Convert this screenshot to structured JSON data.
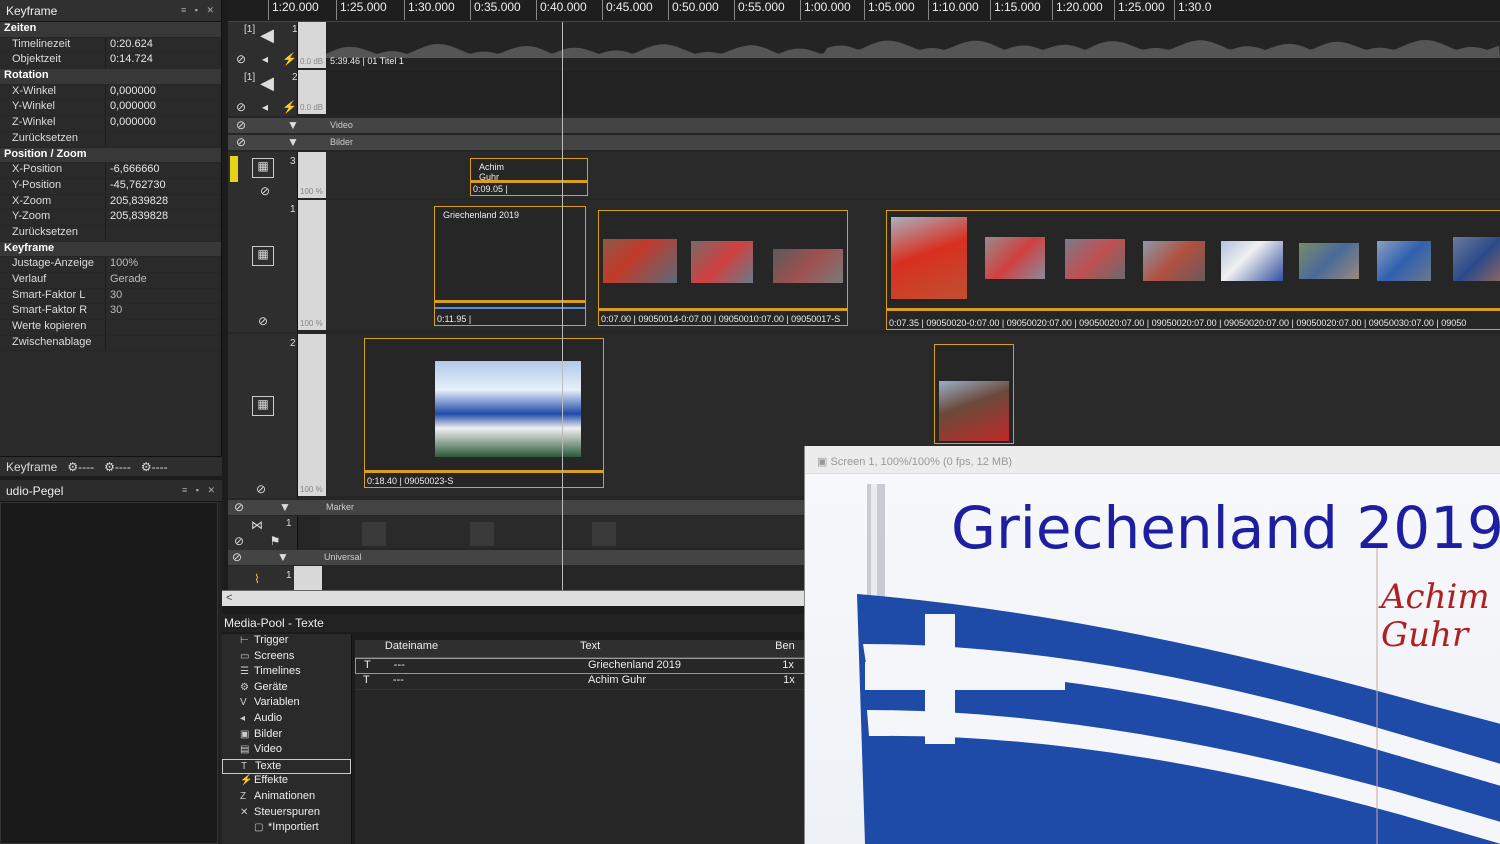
{
  "keyframe_panel": {
    "title": "Keyframe",
    "rows": [
      {
        "section": true,
        "key": "Zeiten"
      },
      {
        "key": "Timelinezeit",
        "value": "0:20.624"
      },
      {
        "key": "Objektzeit",
        "value": "0:14.724"
      },
      {
        "section": true,
        "key": "Rotation"
      },
      {
        "key": "X-Winkel",
        "value": "0,000000"
      },
      {
        "key": "Y-Winkel",
        "value": "0,000000"
      },
      {
        "key": "Z-Winkel",
        "value": "0,000000"
      },
      {
        "key": "Zurücksetzen",
        "value": ""
      },
      {
        "section": true,
        "key": "Position / Zoom"
      },
      {
        "key": "X-Position",
        "value": "-6,666660"
      },
      {
        "key": "Y-Position",
        "value": "-45,762730"
      },
      {
        "key": "X-Zoom",
        "value": "205,839828"
      },
      {
        "key": "Y-Zoom",
        "value": "205,839828"
      },
      {
        "key": "Zurücksetzen",
        "value": ""
      },
      {
        "section": true,
        "key": "Keyframe"
      },
      {
        "key": "Justage-Anzeige",
        "value": "100%"
      },
      {
        "key": "Verlauf",
        "value": "Gerade"
      },
      {
        "key": "Smart-Faktor L",
        "value": "30"
      },
      {
        "key": "Smart-Faktor R",
        "value": "30"
      },
      {
        "key": "Werte kopieren",
        "value": ""
      },
      {
        "key": "Zwischenablage",
        "value": ""
      }
    ],
    "tab_label": "Keyframe",
    "tab_dashes": "----"
  },
  "audio_panel": {
    "title": "udio-Pegel"
  },
  "ruler": {
    "ticks": [
      "1:20.000",
      "1:25.000",
      "1:30.000",
      "0:35.000",
      "0:40.000",
      "0:45.000",
      "0:50.000",
      "0:55.000",
      "1:00.000",
      "1:05.000",
      "1:10.000",
      "1:15.000",
      "1:20.000",
      "1:25.000",
      "1:30.0"
    ]
  },
  "tracks": {
    "audio1": {
      "badge": "[1]",
      "num": "1",
      "db": "0.0 dB",
      "clip_label": "5:39.46 | 01 Titel 1"
    },
    "audio2": {
      "badge": "[1]",
      "num": "2",
      "db": "0.0 dB"
    },
    "video_bar": "Video",
    "bilder_bar": "Bilder",
    "track3": {
      "num": "3",
      "pct": "100 %",
      "clip_title": "Achim Guhr",
      "clip_label": "0:09.05 |"
    },
    "track1": {
      "num": "1",
      "pct": "100 %",
      "title_clip": {
        "title": "Griechenland 2019",
        "label": "0:11.95 |"
      },
      "group_a_label": "0:07.00 | 09050014-0:07.00 | 09050010:07.00 | 09050017-S",
      "group_b_label": "0:07.35 | 09050020-0:07.00 | 09050020:07.00 | 09050020:07.00 | 09050020:07.00 | 09050020:07.00 | 09050020:07.00 | 09050030:07.00 | 09050"
    },
    "track2": {
      "num": "2",
      "pct": "100 %",
      "clip_label": "0:18.40 | 09050023-S"
    },
    "marker_bar": "Marker",
    "marker_num": "1",
    "universal_bar": "Universal",
    "universal_num": "1"
  },
  "scrollbar": {
    "left_arrow": "<"
  },
  "media_pool": {
    "title": "Media-Pool - Texte",
    "tree": [
      {
        "icon": "trigger-icon",
        "glyph": "⊢",
        "label": "Trigger"
      },
      {
        "icon": "screens-icon",
        "glyph": "▭",
        "label": "Screens"
      },
      {
        "icon": "timelines-icon",
        "glyph": "☰",
        "label": "Timelines"
      },
      {
        "icon": "devices-icon",
        "glyph": "⚙",
        "label": "Geräte"
      },
      {
        "icon": "variables-icon",
        "glyph": "V",
        "label": "Variablen"
      },
      {
        "icon": "audio-icon",
        "glyph": "◂",
        "label": "Audio"
      },
      {
        "icon": "images-icon",
        "glyph": "▣",
        "label": "Bilder"
      },
      {
        "icon": "video-icon",
        "glyph": "▤",
        "label": "Video"
      },
      {
        "icon": "text-icon",
        "glyph": "T",
        "label": "Texte",
        "selected": true
      },
      {
        "icon": "effects-icon",
        "glyph": "⚡",
        "label": "Effekte"
      },
      {
        "icon": "animations-icon",
        "glyph": "Z",
        "label": "Animationen"
      },
      {
        "icon": "control-tracks-icon",
        "glyph": "✕",
        "label": "Steuerspuren"
      },
      {
        "icon": "folder-icon",
        "glyph": "▢",
        "label": "*Importiert"
      }
    ],
    "columns": [
      "Dateiname",
      "Text",
      "Ben"
    ],
    "rows": [
      {
        "icon": "T",
        "name": "---",
        "text": "Griechenland 2019",
        "ben": "1x",
        "selected": true
      },
      {
        "icon": "T",
        "name": "---",
        "text": "Achim  Guhr",
        "ben": "1x"
      }
    ]
  },
  "preview": {
    "title": "Screen 1, 100%/100% (0 fps, 12 MB)",
    "heading": "Griechenland 2019",
    "author_line1": "Achim",
    "author_line2": "Guhr"
  }
}
